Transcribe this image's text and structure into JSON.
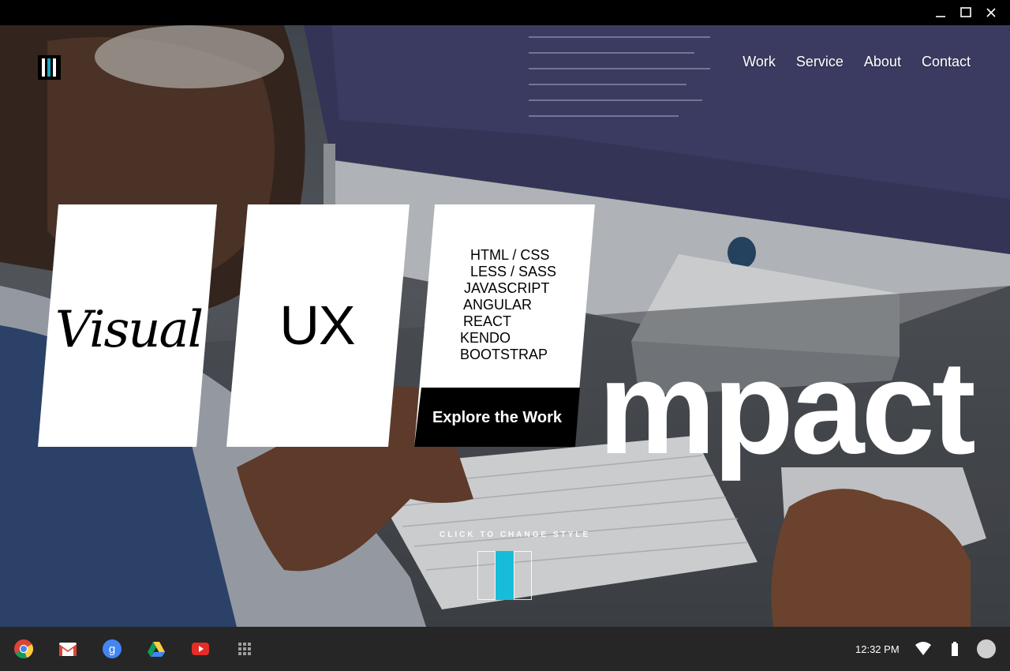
{
  "window": {
    "controls": [
      "minimize",
      "maximize",
      "close"
    ]
  },
  "site": {
    "nav": [
      "Work",
      "Service",
      "About",
      "Contact"
    ],
    "cards": {
      "visual_text": "Visual",
      "ux_text": "UX",
      "tech_list": [
        "HTML / CSS",
        "LESS / SASS",
        "JAVASCRIPT",
        "ANGULAR",
        "REACT",
        "KENDO",
        "BOOTSTRAP"
      ],
      "explore_label": "Explore the Work"
    },
    "hero_word": "mpact",
    "style_switcher": {
      "label": "CLICK TO CHANGE STYLE",
      "swatch_colors": [
        "#1a1a1a",
        "#17bcd8",
        "#1a1a1a"
      ]
    },
    "accent_color": "#17a9c7"
  },
  "shelf": {
    "apps": [
      "chrome-icon",
      "gmail-icon",
      "google-search-icon",
      "drive-icon",
      "youtube-icon",
      "app-launcher-icon"
    ],
    "time": "12:32 PM",
    "status": [
      "wifi-icon",
      "battery-icon",
      "account-avatar"
    ]
  }
}
